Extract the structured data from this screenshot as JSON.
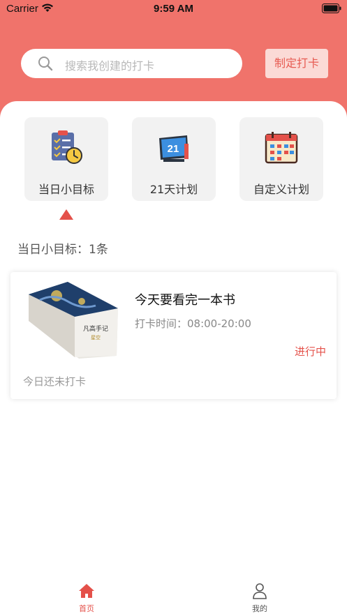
{
  "status_bar": {
    "carrier": "Carrier",
    "time": "9:59 AM"
  },
  "header": {
    "search_placeholder": "搜索我创建的打卡",
    "create_button": "制定打卡"
  },
  "categories": [
    {
      "label": "当日小目标",
      "icon": "checklist-clock-icon",
      "active": true
    },
    {
      "label": "21天计划",
      "icon": "calendar-21-icon",
      "active": false
    },
    {
      "label": "自定义计划",
      "icon": "calendar-grid-icon",
      "active": false
    }
  ],
  "section": {
    "title": "当日小目标：1条"
  },
  "task": {
    "title": "今天要看完一本书",
    "time": "打卡时间：08:00-20:00",
    "status": "进行中",
    "checkin_status": "今日还未打卡",
    "book_title": "凡高手记",
    "book_subtitle": "星空"
  },
  "tabbar": {
    "items": [
      {
        "label": "首页",
        "icon": "home-icon",
        "active": true
      },
      {
        "label": "我的",
        "icon": "person-icon",
        "active": false
      }
    ]
  },
  "colors": {
    "accent": "#f0736b",
    "active": "#e4514a"
  }
}
